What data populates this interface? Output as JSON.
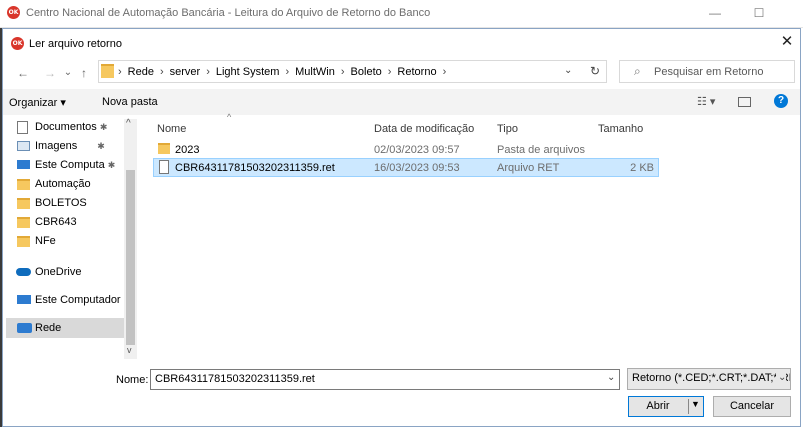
{
  "app": {
    "title": "Centro Nacional de Automação Bancária - Leitura do Arquivo de Retorno do Banco",
    "logo_text": "OK",
    "minimize": "—",
    "maximize": "☐"
  },
  "dialog": {
    "title": "Ler arquivo retorno",
    "close": "✕"
  },
  "address": {
    "back": "←",
    "forward": "→",
    "recent": "⌄",
    "up": "↑",
    "crumbs": [
      "Rede",
      "server",
      "Light System",
      "MultWin",
      "Boleto",
      "Retorno"
    ],
    "refresh": "↻",
    "search_placeholder": "Pesquisar em Retorno"
  },
  "toolbar": {
    "organize": "Organizar ▾",
    "new_folder": "Nova pasta"
  },
  "nav": {
    "items": [
      {
        "label": "Documentos",
        "pinned": true
      },
      {
        "label": "Imagens",
        "pinned": true
      },
      {
        "label": "Este Computa",
        "pinned": true
      },
      {
        "label": "Automação",
        "pinned": false
      },
      {
        "label": "BOLETOS",
        "pinned": false
      },
      {
        "label": "CBR643",
        "pinned": false
      },
      {
        "label": "NFe",
        "pinned": false
      },
      {
        "label": "OneDrive",
        "pinned": false
      },
      {
        "label": "Este Computador",
        "pinned": false
      },
      {
        "label": "Rede",
        "pinned": false
      }
    ],
    "pin_icon": "📌",
    "scroll_up": "^",
    "scroll_down": "v"
  },
  "columns": [
    "Nome",
    "Data de modificação",
    "Tipo",
    "Tamanho"
  ],
  "files": [
    {
      "name": "2023",
      "date": "02/03/2023 09:57",
      "type": "Pasta de arquivos",
      "size": ""
    },
    {
      "name": "CBR64311781503202311359.ret",
      "date": "16/03/2023 09:53",
      "type": "Arquivo RET",
      "size": "2 KB"
    }
  ],
  "bottom": {
    "name_label": "Nome:",
    "name_value": "CBR64311781503202311359.ret",
    "filter": "Retorno (*.CED;*.CRT;*.DAT;*.RE",
    "open": "Abrir",
    "cancel": "Cancelar"
  },
  "colors": {
    "selection": "#cce8ff",
    "accent": "#0078d7"
  }
}
